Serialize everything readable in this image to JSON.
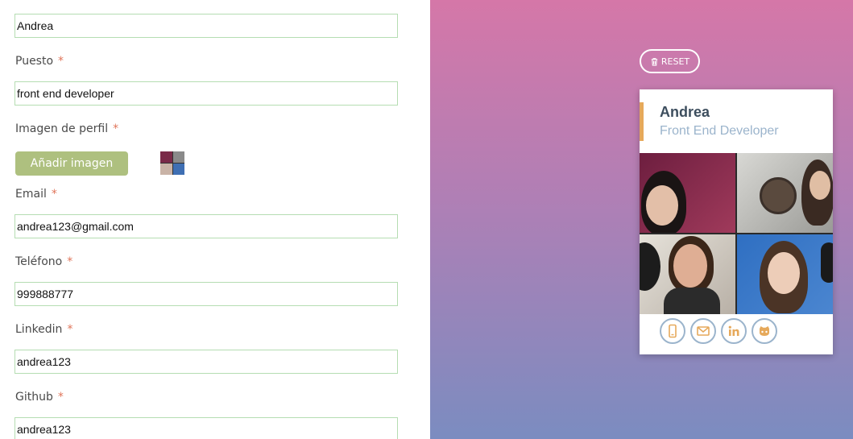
{
  "form": {
    "name_value": "Andrea",
    "job": {
      "label": "Puesto",
      "value": "front end developer"
    },
    "image": {
      "label": "Imagen de perfil",
      "button_label": "Añadir imagen"
    },
    "email": {
      "label": "Email",
      "value": "andrea123@gmail.com"
    },
    "phone": {
      "label": "Teléfono",
      "value": "999888777"
    },
    "linkedin": {
      "label": "Linkedin",
      "value": "andrea123"
    },
    "github": {
      "label": "Github",
      "value": "andrea123"
    },
    "required_mark": "*"
  },
  "preview": {
    "reset_label": "RESET",
    "card": {
      "name": "Andrea",
      "job": "Front End Developer",
      "social_icons": [
        "mobile-icon",
        "mail-icon",
        "linkedin-icon",
        "github-icon"
      ]
    }
  },
  "colors": {
    "accent_orange": "#e6a95b",
    "button_green": "#aec07f",
    "input_border": "#b5ddb2",
    "required": "#e0755a",
    "icon_blue": "#9bb4cc",
    "gradient_top": "#d577a8",
    "gradient_bottom": "#7b8cc0"
  }
}
